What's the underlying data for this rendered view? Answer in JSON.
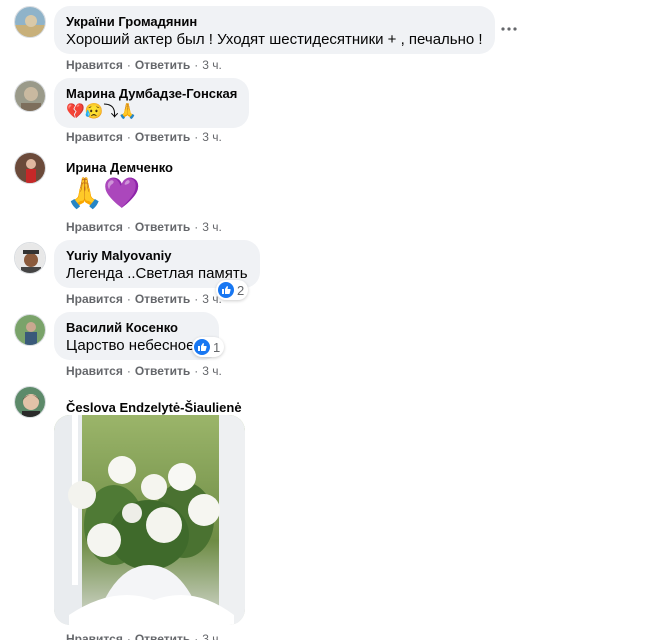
{
  "comments": [
    {
      "author": "України Громадянин",
      "text": "Хороший актер был ! Уходят шестидесятники + , печально !",
      "like_label": "Нравится",
      "reply_label": "Ответить",
      "time": "3 ч."
    },
    {
      "author": "Марина Думбадзе-Гонская",
      "text": "💔😥⤵🙏",
      "like_label": "Нравится",
      "reply_label": "Ответить",
      "time": "3 ч."
    },
    {
      "author": "Ирина Демченко",
      "text": "🙏💜",
      "like_label": "Нравится",
      "reply_label": "Ответить",
      "time": "3 ч."
    },
    {
      "author": "Yuriy Malyovaniy",
      "text": "Легенда ..Светлая память",
      "like_label": "Нравится",
      "reply_label": "Ответить",
      "time": "3 ч.",
      "reaction_count": "2"
    },
    {
      "author": "Василий Косенко",
      "text": "Царство небесное...",
      "like_label": "Нравится",
      "reply_label": "Ответить",
      "time": "3 ч.",
      "reaction_count": "1"
    },
    {
      "author": "Česlova Endzelytė-Šiaulienė",
      "like_label": "Нравится",
      "reply_label": "Ответить",
      "time": "3 ч."
    }
  ],
  "icons": {
    "more": "more-horizontal-icon",
    "like": "thumbs-up-icon"
  },
  "colors": {
    "bubble": "#f0f2f5",
    "secondary_text": "#65676b",
    "like_blue": "#1877f2"
  }
}
